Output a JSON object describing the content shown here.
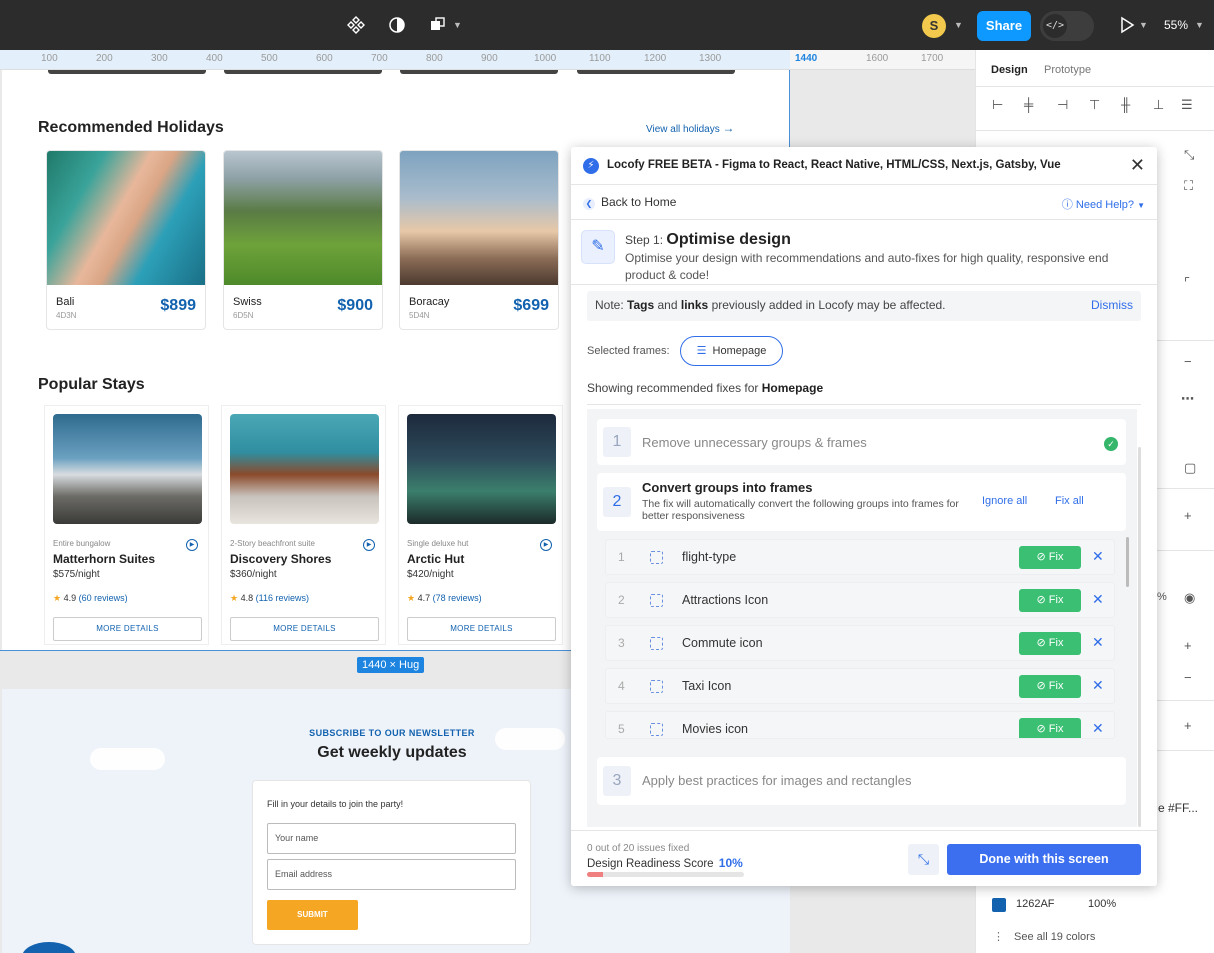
{
  "topbar": {
    "avatar_initial": "S",
    "share_label": "Share",
    "devmode_glyph": "</>",
    "zoom": "55%"
  },
  "ruler": {
    "ticks": [
      "100",
      "200",
      "300",
      "400",
      "500",
      "600",
      "700",
      "800",
      "900",
      "1000",
      "1100",
      "1200",
      "1300"
    ],
    "ticks_right": [
      "1440",
      "1600",
      "1700"
    ]
  },
  "canvas": {
    "recommended": {
      "title": "Recommended Holidays",
      "view_all": "View all holidays",
      "cards": [
        {
          "name": "Bali",
          "duration": "4D3N",
          "price": "$899"
        },
        {
          "name": "Swiss",
          "duration": "6D5N",
          "price": "$900"
        },
        {
          "name": "Boracay",
          "duration": "5D4N",
          "price": "$699"
        }
      ]
    },
    "popular": {
      "title": "Popular Stays",
      "stays": [
        {
          "type": "Entire bungalow",
          "name": "Matterhorn Suites",
          "night": "$575/night",
          "rating": "4.9",
          "reviews": "(60 reviews)",
          "cta": "MORE DETAILS"
        },
        {
          "type": "2-Story beachfront suite",
          "name": "Discovery Shores",
          "night": "$360/night",
          "rating": "4.8",
          "reviews": "(116 reviews)",
          "cta": "MORE DETAILS"
        },
        {
          "type": "Single deluxe hut",
          "name": "Arctic Hut",
          "night": "$420/night",
          "rating": "4.7",
          "reviews": "(78 reviews)",
          "cta": "MORE DETAILS"
        }
      ]
    },
    "size_badge": "1440 × Hug",
    "newsletter": {
      "kicker": "SUBSCRIBE TO OUR NEWSLETTER",
      "title": "Get weekly updates",
      "label": "Fill in your details to join the party!",
      "name_placeholder": "Your name",
      "email_placeholder": "Email address",
      "submit": "SUBMIT"
    }
  },
  "right_panel": {
    "tabs": [
      "Design",
      "Prototype"
    ],
    "percent": "%",
    "color_label": "e #FF...",
    "color_hex": "1262AF",
    "color_opacity": "100%",
    "see_all": "See all 19 colors",
    "swatch_color": "#1262AF"
  },
  "plugin": {
    "title": "Locofy FREE BETA - Figma to React, React Native, HTML/CSS, Next.js, Gatsby, Vue",
    "back": "Back to Home",
    "help": "Need Help?",
    "step_label": "Step 1:",
    "step_title": "Optimise design",
    "step_desc": "Optimise your design with recommendations and auto-fixes for high quality, responsive end product & code!",
    "note_prefix": "Note:",
    "note_tags": "Tags",
    "note_and": "and",
    "note_links": "links",
    "note_suffix": "previously added in Locofy may be affected.",
    "dismiss": "Dismiss",
    "selected_label": "Selected frames:",
    "selected_frame": "Homepage",
    "showing_prefix": "Showing recommended fixes for",
    "showing_frame": "Homepage",
    "groups": [
      {
        "num": "1",
        "title": "Remove unnecessary groups & frames"
      },
      {
        "num": "2",
        "title": "Convert groups into frames",
        "desc": "The fix will automatically convert the following groups into frames for better responsiveness",
        "ignore_all": "Ignore all",
        "fix_all": "Fix all"
      },
      {
        "num": "3",
        "title": "Apply best practices for images and rectangles"
      }
    ],
    "fix_items": [
      {
        "idx": "1",
        "name": "flight-type"
      },
      {
        "idx": "2",
        "name": "Attractions Icon"
      },
      {
        "idx": "3",
        "name": "Commute icon"
      },
      {
        "idx": "4",
        "name": "Taxi Icon"
      },
      {
        "idx": "5",
        "name": "Movies icon"
      }
    ],
    "fix_label": "Fix",
    "issues_fixed": "0 out of 20 issues fixed",
    "score_label": "Design Readiness Score",
    "score_value": "10%",
    "score_fraction": 0.1,
    "done": "Done with this screen"
  }
}
